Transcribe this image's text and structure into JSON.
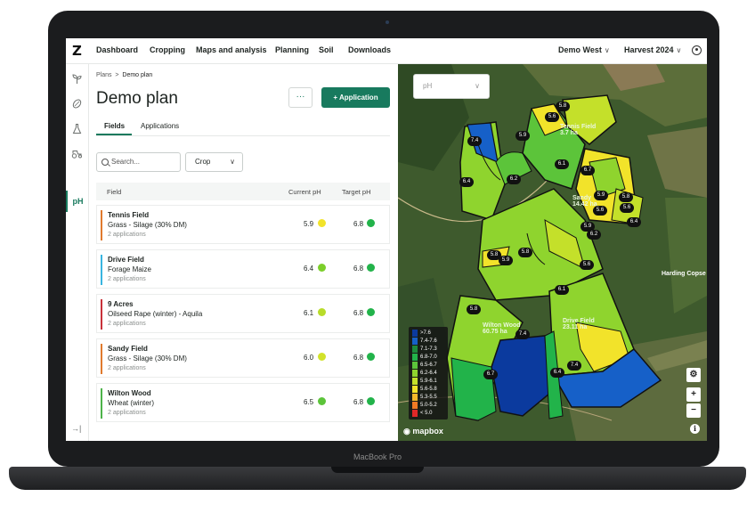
{
  "device": {
    "model_label": "MacBook Pro"
  },
  "topbar": {
    "logo": "Z",
    "nav": [
      "Dashboard",
      "Cropping",
      "Maps and analysis",
      "Planning",
      "Soil",
      "Downloads"
    ],
    "farm_select": "Demo West",
    "harvest_select": "Harvest 2024",
    "chevron": "∨"
  },
  "rail": {
    "active_label": "pH",
    "collapse": "→|"
  },
  "panel": {
    "breadcrumb": {
      "parent": "Plans",
      "separator": ">",
      "current": "Demo plan"
    },
    "title": "Demo plan",
    "more_label": "···",
    "primary_button": "+  Application",
    "tabs": [
      "Fields",
      "Applications"
    ],
    "search_placeholder": "Search...",
    "crop_filter": "Crop",
    "table_headers": {
      "field": "Field",
      "current": "Current pH",
      "target": "Target pH"
    },
    "rows": [
      {
        "name": "Tennis Field",
        "crop": "Grass - Silage (30% DM)",
        "apps": "2 applications",
        "current_ph": "5.9",
        "target_ph": "6.8",
        "bar_color": "#e07a2e",
        "current_color": "#f2e32a",
        "target_color": "#22b34a"
      },
      {
        "name": "Drive Field",
        "crop": "Forage Maize",
        "apps": "2 applications",
        "current_ph": "6.4",
        "target_ph": "6.8",
        "bar_color": "#39b5e0",
        "current_color": "#7ccf2a",
        "target_color": "#22b34a"
      },
      {
        "name": "9 Acres",
        "crop": "Oilseed Rape (winter) - Aquila",
        "apps": "2 applications",
        "current_ph": "6.1",
        "target_ph": "6.8",
        "bar_color": "#c8323a",
        "current_color": "#b8dc2a",
        "target_color": "#22b34a"
      },
      {
        "name": "Sandy Field",
        "crop": "Grass - Silage (30% DM)",
        "apps": "2 applications",
        "current_ph": "6.0",
        "target_ph": "6.8",
        "bar_color": "#e07a2e",
        "current_color": "#d2e22a",
        "target_color": "#22b34a"
      },
      {
        "name": "Wilton Wood",
        "crop": "Wheat (winter)",
        "apps": "2 applications",
        "current_ph": "6.5",
        "target_ph": "6.8",
        "bar_color": "#4db34a",
        "current_color": "#5cc43a",
        "target_color": "#22b34a"
      }
    ]
  },
  "map": {
    "ph_select": "pH",
    "legend": [
      {
        "label": ">7.6",
        "color": "#0b3a9e"
      },
      {
        "label": "7.4-7.6",
        "color": "#1660c8"
      },
      {
        "label": "7.1-7.3",
        "color": "#1e8a3c"
      },
      {
        "label": "6.8-7.0",
        "color": "#22b34a"
      },
      {
        "label": "6.5-6.7",
        "color": "#5cc43a"
      },
      {
        "label": "6.2-6.4",
        "color": "#8fd42e"
      },
      {
        "label": "5.9-6.1",
        "color": "#c4e02a"
      },
      {
        "label": "5.6-5.8",
        "color": "#f2e32a"
      },
      {
        "label": "5.3-5.5",
        "color": "#f5b82a"
      },
      {
        "label": "5.0-5.2",
        "color": "#f07a24"
      },
      {
        "label": "< 5.0",
        "color": "#e02828"
      }
    ],
    "field_labels": [
      {
        "name": "Tennis Field",
        "area": "3.7 ha"
      },
      {
        "name": "Sandy",
        "area": "14.42 ha"
      },
      {
        "name": "",
        "area": ""
      },
      {
        "name": "Wilton Wood",
        "area": "60.75 ha"
      },
      {
        "name": "Drive Field",
        "area": "23.11 ha"
      }
    ],
    "ph_values": [
      "5.8",
      "5.6",
      "7.4",
      "5.9",
      "6.1",
      "6.7",
      "6.4",
      "6.2",
      "5.9",
      "5.6",
      "5.9",
      "5.8",
      "5.6",
      "6.4",
      "6.2",
      "5.8",
      "5.8",
      "6.1",
      "5.6",
      "5.9",
      "5.8",
      "7.4",
      "6.7",
      "6.4",
      "7.4",
      "5.8",
      "5.6",
      "6.2",
      "5.8",
      "5.9",
      "6.1"
    ],
    "place_label": "Harding Copse",
    "controls": {
      "settings": "⚙",
      "zoom_in": "+",
      "zoom_out": "−"
    },
    "attribution": "mapbox",
    "info": "i"
  }
}
